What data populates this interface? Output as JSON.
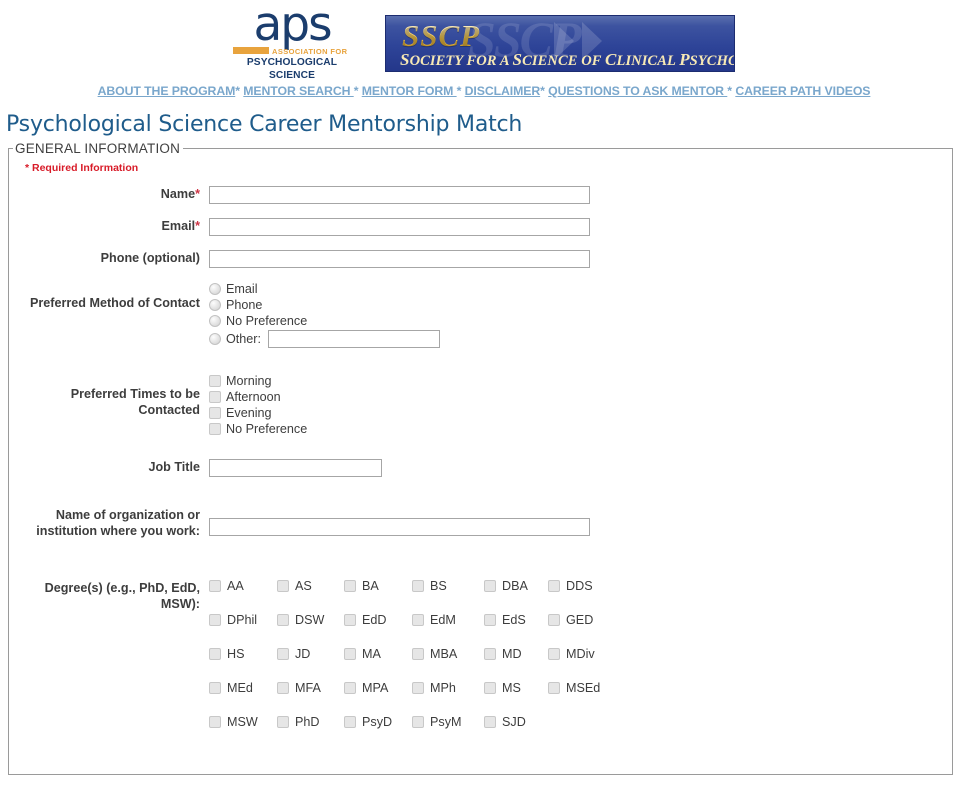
{
  "header": {
    "aps_logo": {
      "wordmark": "aps",
      "association_for": "ASSOCIATION FOR",
      "psychological_science": "PSYCHOLOGICAL SCIENCE"
    },
    "sscp_banner": {
      "acronym": "SSCP",
      "tagline_parts": {
        "s1": "S",
        "w1": "OCIETY FOR A ",
        "s2": "S",
        "w2": "CIENCE OF ",
        "s3": "C",
        "w3": "LINICAL ",
        "s4": "P",
        "w4": "SYCHOLOGY"
      },
      "tagline_full": "SOCIETY FOR A SCIENCE OF CLINICAL PSYCHOLOGY",
      "background_color": "#2e4498",
      "acronym_color": "#f3c94f"
    }
  },
  "nav": {
    "separator": "*",
    "link_color": "#7aa7cc",
    "items": [
      {
        "label": "ABOUT THE PROGRAM"
      },
      {
        "label": "MENTOR SEARCH "
      },
      {
        "label": "MENTOR FORM "
      },
      {
        "label": "DISCLAIMER"
      },
      {
        "label": "QUESTIONS TO ASK MENTOR "
      },
      {
        "label": "CAREER PATH VIDEOS"
      }
    ]
  },
  "page": {
    "title": "Psychological Science Career Mentorship Match",
    "title_color": "#1f5c8b"
  },
  "fieldset": {
    "legend": "GENERAL INFORMATION",
    "required_note": "* Required Information",
    "required_note_color": "#d81b28"
  },
  "form": {
    "name": {
      "label": "Name",
      "required_marker": "*",
      "value": "",
      "placeholder": ""
    },
    "email": {
      "label": "Email",
      "required_marker": "*",
      "value": "",
      "placeholder": ""
    },
    "phone": {
      "label": "Phone (optional)",
      "value": "",
      "placeholder": ""
    },
    "preferred_contact": {
      "label": "Preferred Method of Contact",
      "options": [
        {
          "label": "Email",
          "checked": false
        },
        {
          "label": "Phone",
          "checked": false
        },
        {
          "label": "No Preference",
          "checked": false
        },
        {
          "label": "Other:",
          "checked": false
        }
      ],
      "other_value": "",
      "other_placeholder": ""
    },
    "preferred_times": {
      "label": "Preferred Times to be Contacted",
      "options": [
        {
          "label": "Morning",
          "checked": false
        },
        {
          "label": "Afternoon",
          "checked": false
        },
        {
          "label": "Evening",
          "checked": false
        },
        {
          "label": "No Preference",
          "checked": false
        }
      ]
    },
    "job_title": {
      "label": "Job Title",
      "value": "",
      "placeholder": ""
    },
    "organization": {
      "label": "Name of organization or institution where you work:",
      "value": "",
      "placeholder": ""
    },
    "degrees": {
      "label": "Degree(s) (e.g., PhD, EdD, MSW):",
      "options": [
        {
          "label": "AA",
          "checked": false
        },
        {
          "label": "AS",
          "checked": false
        },
        {
          "label": "BA",
          "checked": false
        },
        {
          "label": "BS",
          "checked": false
        },
        {
          "label": "DBA",
          "checked": false
        },
        {
          "label": "DDS",
          "checked": false
        },
        {
          "label": "DPhil",
          "checked": false
        },
        {
          "label": "DSW",
          "checked": false
        },
        {
          "label": "EdD",
          "checked": false
        },
        {
          "label": "EdM",
          "checked": false
        },
        {
          "label": "EdS",
          "checked": false
        },
        {
          "label": "GED",
          "checked": false
        },
        {
          "label": "HS",
          "checked": false
        },
        {
          "label": "JD",
          "checked": false
        },
        {
          "label": "MA",
          "checked": false
        },
        {
          "label": "MBA",
          "checked": false
        },
        {
          "label": "MD",
          "checked": false
        },
        {
          "label": "MDiv",
          "checked": false
        },
        {
          "label": "MEd",
          "checked": false
        },
        {
          "label": "MFA",
          "checked": false
        },
        {
          "label": "MPA",
          "checked": false
        },
        {
          "label": "MPh",
          "checked": false
        },
        {
          "label": "MS",
          "checked": false
        },
        {
          "label": "MSEd",
          "checked": false
        },
        {
          "label": "MSW",
          "checked": false
        },
        {
          "label": "PhD",
          "checked": false
        },
        {
          "label": "PsyD",
          "checked": false
        },
        {
          "label": "PsyM",
          "checked": false
        },
        {
          "label": "SJD",
          "checked": false
        }
      ]
    }
  }
}
